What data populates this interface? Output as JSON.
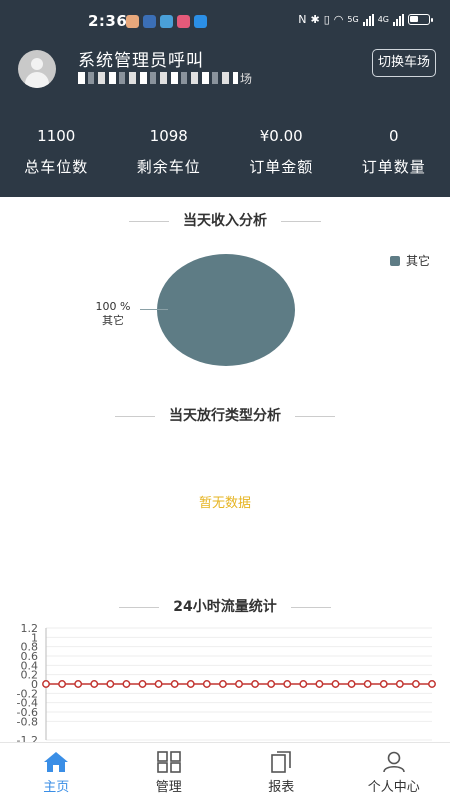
{
  "status_bar": {
    "time": "2:36",
    "net_5g": "5G",
    "net_4g": "4G"
  },
  "user": {
    "name": "系统管理员呼叫",
    "parking_lot_suffix": "场"
  },
  "header": {
    "switch_label": "切换车场"
  },
  "stats": [
    {
      "value": "1100",
      "label": "总车位数"
    },
    {
      "value": "1098",
      "label": "剩余车位"
    },
    {
      "value": "¥0.00",
      "label": "订单金额"
    },
    {
      "value": "0",
      "label": "订单数量"
    }
  ],
  "income_section": {
    "title": "当天收入分析"
  },
  "release_section": {
    "title": "当天放行类型分析",
    "empty_text": "暂无数据"
  },
  "flow_section": {
    "title": "24小时流量统计"
  },
  "colors": {
    "header_bg": "#2d3945",
    "pie": "#5e7c85",
    "line": "#c23531",
    "active_tab": "#3a8ee6",
    "empty_text": "#e6b422"
  },
  "chart_data": [
    {
      "type": "pie",
      "title": "当天收入分析",
      "slices": [
        {
          "name": "其它",
          "value": 100,
          "label": "100 %\n其它"
        }
      ],
      "legend_position": "top-right"
    },
    {
      "type": "line",
      "title": "24小时流量统计",
      "y_ticks": [
        1.2,
        1.0,
        0.8,
        0.6,
        0.4,
        0.2,
        0,
        -0.2,
        -0.4,
        -0.6,
        -0.8,
        -1.2
      ],
      "ylim": [
        -1.2,
        1.2
      ],
      "series": [
        {
          "values": [
            0,
            0,
            0,
            0,
            0,
            0,
            0,
            0,
            0,
            0,
            0,
            0,
            0,
            0,
            0,
            0,
            0,
            0,
            0,
            0,
            0,
            0,
            0,
            0,
            0
          ]
        }
      ],
      "grid": true
    }
  ],
  "tabs": [
    {
      "label": "主页",
      "icon": "home-icon",
      "active": true
    },
    {
      "label": "管理",
      "icon": "grid-icon",
      "active": false
    },
    {
      "label": "报表",
      "icon": "report-icon",
      "active": false
    },
    {
      "label": "个人中心",
      "icon": "user-icon",
      "active": false
    }
  ]
}
